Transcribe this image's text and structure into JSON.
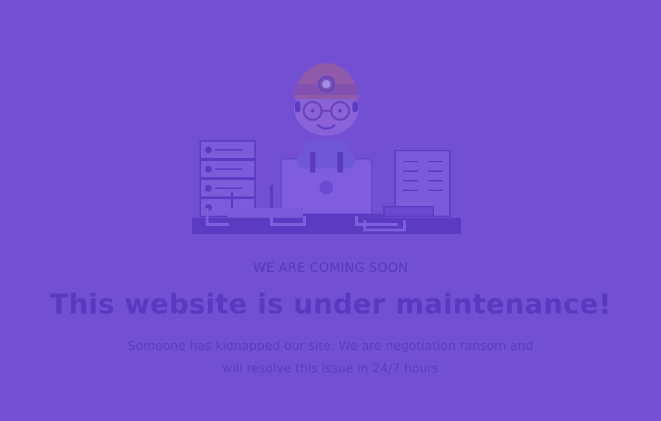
{
  "page": {
    "tagline": "WE ARE COMING SOON",
    "headline": "This website is under maintenance!",
    "message": "Someone has kidnapped our site. We are negotiation ransom and will resolve this issue in 24/7 hours"
  },
  "illustration": {
    "icon": "maintenance-worker-illustration",
    "colors": {
      "background": "#7350d3",
      "primary_shape": "#5b3bbd",
      "light_shape": "#7e5bd8",
      "accent": "#8b62d5"
    }
  }
}
